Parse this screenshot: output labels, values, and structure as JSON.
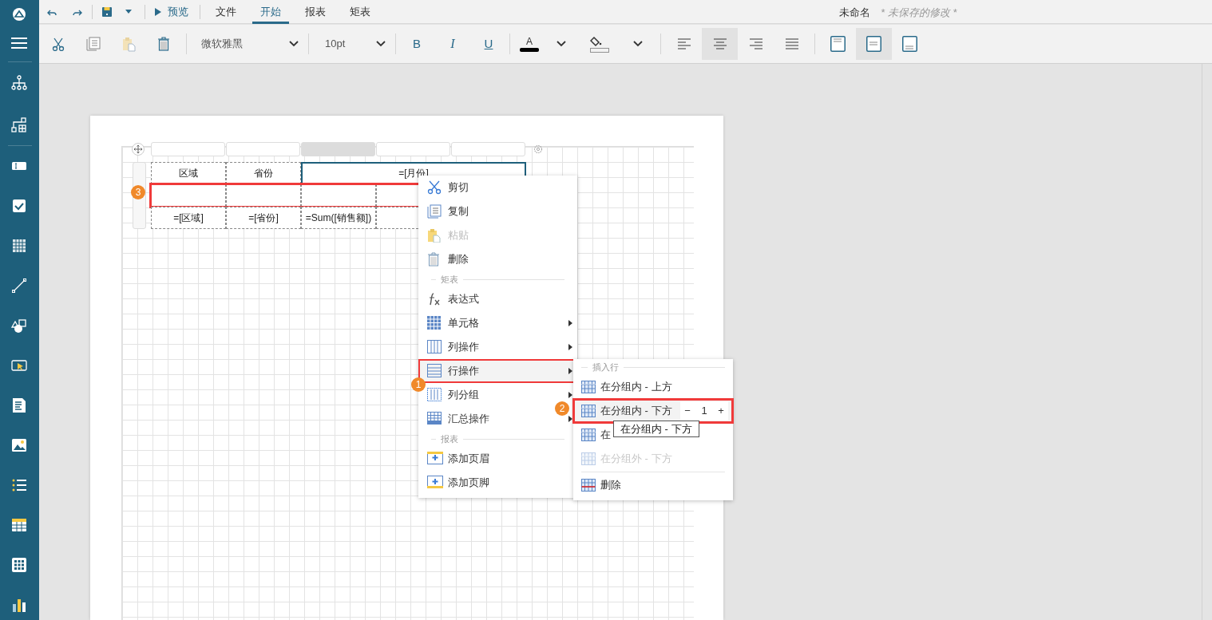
{
  "topbar": {
    "preview": "预览",
    "tabs": [
      {
        "label": "文件",
        "selected": false
      },
      {
        "label": "开始",
        "selected": true
      },
      {
        "label": "报表",
        "selected": false
      },
      {
        "label": "矩表",
        "selected": false
      }
    ],
    "doc_name": "未命名",
    "unsaved_note": "* 未保存的修改 *"
  },
  "toolbar": {
    "font": "微软雅黑",
    "font_size": "10pt",
    "bold": "B",
    "italic": "I",
    "underline": "U",
    "font_color_glyph": "A",
    "h_align": [
      {
        "selected": false
      },
      {
        "selected": true
      },
      {
        "selected": false
      },
      {
        "selected": false
      }
    ],
    "v_align": [
      {
        "selected": false
      },
      {
        "selected": true
      },
      {
        "selected": false
      }
    ]
  },
  "matrix": {
    "column_headers": [
      {
        "selected": false
      },
      {
        "selected": false
      },
      {
        "selected": true
      },
      {
        "selected": false
      },
      {
        "selected": false
      }
    ],
    "rows": [
      {
        "highlighted": false,
        "cells": [
          {
            "text": "区域",
            "selected": false
          },
          {
            "text": "省份",
            "selected": false
          },
          {
            "text": "=[月份]",
            "selected": true
          }
        ]
      },
      {
        "highlighted": true,
        "cells": [
          {
            "selected": false
          },
          {
            "selected": false
          },
          {
            "selected": false
          },
          {
            "selected": false
          }
        ]
      },
      {
        "highlighted": false,
        "cells": [
          {
            "text": "=[区域]",
            "selected": false
          },
          {
            "text": "=[省份]",
            "selected": false
          },
          {
            "text": "=Sum([销售额])",
            "selected": false
          },
          {
            "selected": false
          }
        ]
      }
    ]
  },
  "context_menu": {
    "items": [
      {
        "kind": "item",
        "label": "剪切",
        "disabled": false,
        "submenu": false,
        "highlighted": false
      },
      {
        "kind": "item",
        "label": "复制",
        "disabled": false,
        "submenu": false,
        "highlighted": false
      },
      {
        "kind": "item",
        "label": "粘贴",
        "disabled": true,
        "submenu": false,
        "highlighted": false
      },
      {
        "kind": "item",
        "label": "删除",
        "disabled": false,
        "submenu": false,
        "highlighted": false
      },
      {
        "kind": "section",
        "label": "矩表"
      },
      {
        "kind": "item",
        "label": "表达式",
        "disabled": false,
        "submenu": false,
        "highlighted": false
      },
      {
        "kind": "item",
        "label": "单元格",
        "disabled": false,
        "submenu": true,
        "highlighted": false
      },
      {
        "kind": "item",
        "label": "列操作",
        "disabled": false,
        "submenu": true,
        "highlighted": false
      },
      {
        "kind": "item",
        "label": "行操作",
        "disabled": false,
        "submenu": true,
        "highlighted": true
      },
      {
        "kind": "item",
        "label": "列分组",
        "disabled": false,
        "submenu": true,
        "highlighted": false
      },
      {
        "kind": "item",
        "label": "汇总操作",
        "disabled": false,
        "submenu": true,
        "highlighted": false
      },
      {
        "kind": "section",
        "label": "报表"
      },
      {
        "kind": "item",
        "label": "添加页眉",
        "disabled": false,
        "submenu": false,
        "highlighted": false
      },
      {
        "kind": "item",
        "label": "添加页脚",
        "disabled": false,
        "submenu": false,
        "highlighted": false
      }
    ]
  },
  "submenu": {
    "items": [
      {
        "kind": "section",
        "label": "插入行"
      },
      {
        "kind": "item",
        "label": "在分组内 - 上方",
        "disabled": false,
        "highlighted": false
      },
      {
        "kind": "item",
        "label": "在分组内 - 下方",
        "disabled": false,
        "highlighted": true,
        "stepper": {
          "minus": "−",
          "value": "1",
          "plus": "+"
        }
      },
      {
        "kind": "item",
        "label": "在",
        "disabled": false,
        "highlighted": false
      },
      {
        "kind": "item",
        "label": "在分组外 - 下方",
        "disabled": true,
        "highlighted": false
      },
      {
        "kind": "divider"
      },
      {
        "kind": "item",
        "label": "删除",
        "disabled": false,
        "highlighted": false,
        "danger": true
      }
    ]
  },
  "tooltip": "在分组内 - 下方",
  "callouts": [
    "1",
    "2",
    "3"
  ]
}
